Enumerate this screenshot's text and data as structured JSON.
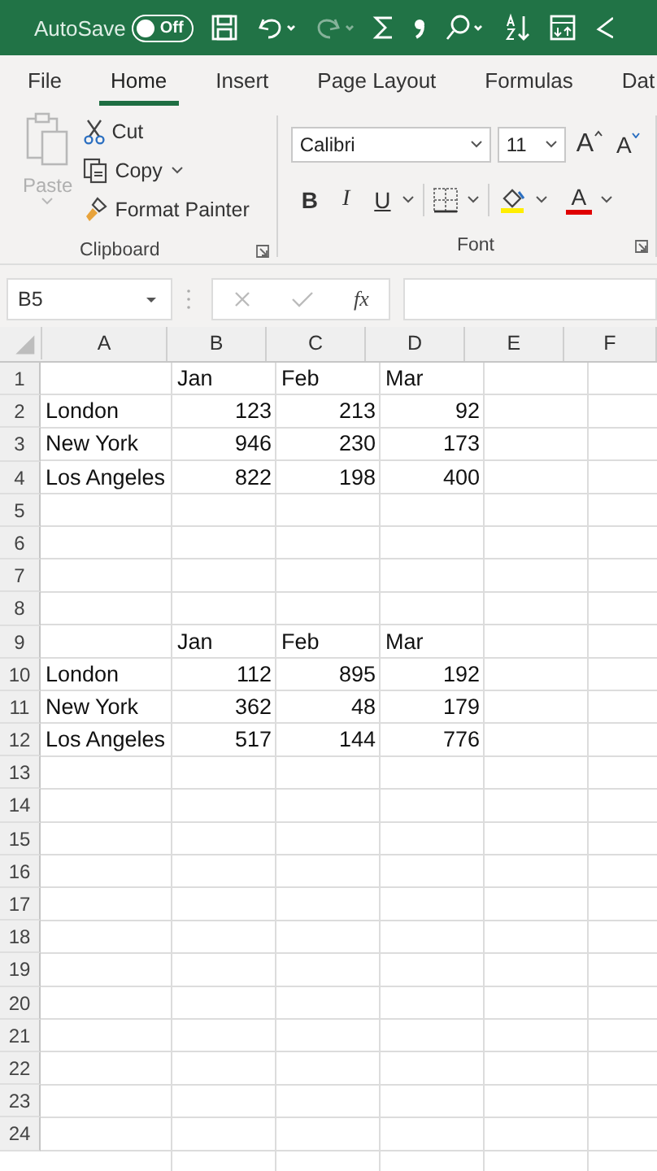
{
  "title_bar": {
    "autosave_label": "AutoSave",
    "autosave_toggle": {
      "label": "Off",
      "on": false
    }
  },
  "tabs": [
    {
      "label": "File",
      "selected": false
    },
    {
      "label": "Home",
      "selected": true
    },
    {
      "label": "Insert",
      "selected": false
    },
    {
      "label": "Page Layout",
      "selected": false
    },
    {
      "label": "Formulas",
      "selected": false
    },
    {
      "label": "Dat",
      "selected": false
    }
  ],
  "clipboard": {
    "paste": {
      "label": "Paste",
      "disabled": true
    },
    "cut": "Cut",
    "copy": "Copy",
    "format_painter": "Format Painter",
    "group_label": "Clipboard"
  },
  "font": {
    "font_name": "Calibri",
    "font_size": "11",
    "grow": "A",
    "shrink": "A",
    "bold": "B",
    "italic": "I",
    "underline": "U",
    "font_color": "A",
    "group_label": "Font"
  },
  "formula_bar": {
    "name_box": "B5",
    "function_label": "fx"
  },
  "sheet": {
    "columns": [
      "A",
      "B",
      "C",
      "D",
      "E",
      "F"
    ],
    "rows": [
      {
        "number": "1",
        "kind": "labels",
        "cells": {
          "B": "Jan",
          "C": "Feb",
          "D": "Mar"
        }
      },
      {
        "number": "2",
        "kind": "values",
        "cells": {
          "A": "London",
          "B": "123",
          "C": "213",
          "D": "92"
        }
      },
      {
        "number": "3",
        "kind": "values",
        "cells": {
          "A": "New York",
          "B": "946",
          "C": "230",
          "D": "173"
        }
      },
      {
        "number": "4",
        "kind": "values",
        "cells": {
          "A": "Los Angeles",
          "B": "822",
          "C": "198",
          "D": "400"
        }
      },
      {
        "number": "5"
      },
      {
        "number": "6"
      },
      {
        "number": "7"
      },
      {
        "number": "8"
      },
      {
        "number": "9",
        "kind": "labels",
        "cells": {
          "B": "Jan",
          "C": "Feb",
          "D": "Mar"
        }
      },
      {
        "number": "10",
        "kind": "values",
        "cells": {
          "A": "London",
          "B": "112",
          "C": "895",
          "D": "192"
        }
      },
      {
        "number": "11",
        "kind": "values",
        "cells": {
          "A": "New York",
          "B": "362",
          "C": "48",
          "D": "179"
        }
      },
      {
        "number": "12",
        "kind": "values",
        "cells": {
          "A": "Los Angeles",
          "B": "517",
          "C": "144",
          "D": "776"
        }
      },
      {
        "number": "13"
      },
      {
        "number": "14"
      },
      {
        "number": "15"
      },
      {
        "number": "16"
      },
      {
        "number": "17"
      },
      {
        "number": "18"
      },
      {
        "number": "19"
      },
      {
        "number": "20"
      },
      {
        "number": "21"
      },
      {
        "number": "22"
      },
      {
        "number": "23"
      },
      {
        "number": "24"
      }
    ]
  }
}
